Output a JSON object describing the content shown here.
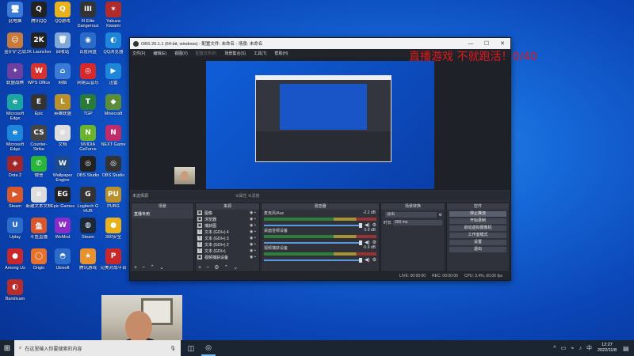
{
  "desktop": {
    "icons": [
      {
        "label": "此电脑",
        "glyph": "🖥",
        "color": "#3b7bd8"
      },
      {
        "label": "腾讯QQ",
        "glyph": "Q",
        "color": "#222"
      },
      {
        "label": "QQ游戏",
        "glyph": "Q",
        "color": "#e8b21c"
      },
      {
        "label": "III Elite Dangerous",
        "glyph": "III",
        "color": "#333"
      },
      {
        "label": "Yakuza Kiwami",
        "glyph": "✶",
        "color": "#b02c2c"
      },
      {
        "label": "金铲铲之战",
        "glyph": "☺",
        "color": "#c87a3a"
      },
      {
        "label": "2K Launcher",
        "glyph": "2K",
        "color": "#222"
      },
      {
        "label": "回收站",
        "glyph": "🗑",
        "color": "#7fa8d8"
      },
      {
        "label": "百度网盘",
        "glyph": "◉",
        "color": "#2a6cc8"
      },
      {
        "label": "QQ浏览器",
        "glyph": "◐",
        "color": "#1d86d8"
      },
      {
        "label": "联盟战棋",
        "glyph": "✦",
        "color": "#6c3fa0"
      },
      {
        "label": "WPS Office",
        "glyph": "W",
        "color": "#d8322c"
      },
      {
        "label": "网络",
        "glyph": "⌂",
        "color": "#3b7bd8"
      },
      {
        "label": "网易云音乐",
        "glyph": "◎",
        "color": "#d8282c"
      },
      {
        "label": "迅雷",
        "glyph": "▶",
        "color": "#1d86d8"
      },
      {
        "label": "Microsoft Edge",
        "glyph": "e",
        "color": "#1da5a0"
      },
      {
        "label": "Epic",
        "glyph": "E",
        "color": "#333"
      },
      {
        "label": "英雄联盟",
        "glyph": "L",
        "color": "#b8902c"
      },
      {
        "label": "TGP",
        "glyph": "T",
        "color": "#2a7a3a"
      },
      {
        "label": "Minecraft",
        "glyph": "◆",
        "color": "#5a8c3a"
      },
      {
        "label": "Microsoft Edge",
        "glyph": "e",
        "color": "#1d86d8"
      },
      {
        "label": "Counter-Strike",
        "glyph": "CS",
        "color": "#444"
      },
      {
        "label": "文档",
        "glyph": "≡",
        "color": "#ddd"
      },
      {
        "label": "NVIDIA GeForce",
        "glyph": "N",
        "color": "#6ab42c"
      },
      {
        "label": "NEXT Game",
        "glyph": "N",
        "color": "#c02c6a"
      },
      {
        "label": "Dota 2",
        "glyph": "◈",
        "color": "#a0282c"
      },
      {
        "label": "微信",
        "glyph": "✆",
        "color": "#2ab43a"
      },
      {
        "label": "Wallpaper Engine",
        "glyph": "W",
        "color": "#1d4a8c"
      },
      {
        "label": "OBS Studio",
        "glyph": "◎",
        "color": "#222"
      },
      {
        "label": "OBS Studio",
        "glyph": "◎",
        "color": "#333"
      },
      {
        "label": "Steam",
        "glyph": "▶",
        "color": "#d8582c"
      },
      {
        "label": "新建文本文档",
        "glyph": "≡",
        "color": "#ddd"
      },
      {
        "label": "Epic Games",
        "glyph": "EG",
        "color": "#222"
      },
      {
        "label": "Logitech G HUB",
        "glyph": "G",
        "color": "#333"
      },
      {
        "label": "PUBG",
        "glyph": "PU",
        "color": "#b8902c"
      },
      {
        "label": "Uplay",
        "glyph": "U",
        "color": "#2a6cc8"
      },
      {
        "label": "斗鱼直播",
        "glyph": "鱼",
        "color": "#d8582c"
      },
      {
        "label": "WeMod",
        "glyph": "W",
        "color": "#8a2cc8"
      },
      {
        "label": "Steam",
        "glyph": "◍",
        "color": "#1b2838"
      },
      {
        "label": "360安全",
        "glyph": "●",
        "color": "#e8b21c"
      },
      {
        "label": "Among Us",
        "glyph": "●",
        "color": "#c8282c"
      },
      {
        "label": "Origin",
        "glyph": "◯",
        "color": "#e8722c"
      },
      {
        "label": "Ubisoft",
        "glyph": "◓",
        "color": "#2a6cc8"
      },
      {
        "label": "腾讯游戏",
        "glyph": "★",
        "color": "#e8922c"
      },
      {
        "label": "完美对战平台",
        "glyph": "P",
        "color": "#c8282c"
      },
      {
        "label": "Bandicam",
        "glyph": "◐",
        "color": "#b82c2c"
      }
    ]
  },
  "obs": {
    "title": "OBS 26.1.1 (64-bit, windows) - 配置文件: 未命名 - 场景: 未命名",
    "window_buttons": [
      "—",
      "☐",
      "✕"
    ],
    "menu": [
      "文件(F)",
      "编辑(E)",
      "视图(V)",
      "配置文件(P)",
      "场景集合(S)",
      "工具(T)",
      "帮助(H)"
    ],
    "overlay_text": "直播游戏 不就跑活！0/40",
    "status_row_left": "未选择源",
    "status_row_mid": "⚙属性   ⚙滤镜",
    "docks": {
      "scenes": {
        "title": "场景",
        "items": [
          "直播专用"
        ]
      },
      "sources": {
        "title": "来源",
        "items": [
          {
            "name": "图像",
            "icon": "▣"
          },
          {
            "name": "浏览器",
            "icon": "▣"
          },
          {
            "name": "捕获图",
            "icon": "▣"
          },
          {
            "name": "文本 (GDI+) 4",
            "icon": "T"
          },
          {
            "name": "文本 (GDI+) 3",
            "icon": "T"
          },
          {
            "name": "文本 (GDI+) 2",
            "icon": "T"
          },
          {
            "name": "文本 (GDI+)",
            "icon": "T"
          },
          {
            "name": "视频捕获设备",
            "icon": "▣"
          }
        ]
      },
      "mixer": {
        "title": "混音器",
        "channels": [
          {
            "name": "麦克风/Aux",
            "db": "-2.2 dB"
          },
          {
            "name": "桌面音频设备",
            "db": "0.0 dB"
          },
          {
            "name": "视频捕获设备",
            "db": "-5.6 dB"
          }
        ]
      },
      "transitions": {
        "title": "场景转换",
        "type": "淡出",
        "duration_label": "时长",
        "duration_value": "300 ms"
      },
      "controls": {
        "title": "控件",
        "buttons": [
          "停止推流",
          "开始录制",
          "启动虚拟摄像机",
          "工作室模式",
          "设置",
          "退出"
        ]
      }
    },
    "footer": {
      "live": "LIVE: 00:00:00",
      "rec": "REC: 00:00:00",
      "cpu": "CPU: 3.4%, 60.00 fps"
    }
  },
  "taskbar": {
    "start_icon": "⊞",
    "search_placeholder": "在这里输入你要搜索的内容",
    "search_icon": "⌕",
    "mic_icon": "🎙",
    "apps": [
      "◫",
      "◎"
    ],
    "tray": [
      "^",
      "▭",
      "⌁",
      "♪",
      "中"
    ],
    "time": "12:27",
    "date": "2022/11/8",
    "notification_icon": "▤"
  }
}
